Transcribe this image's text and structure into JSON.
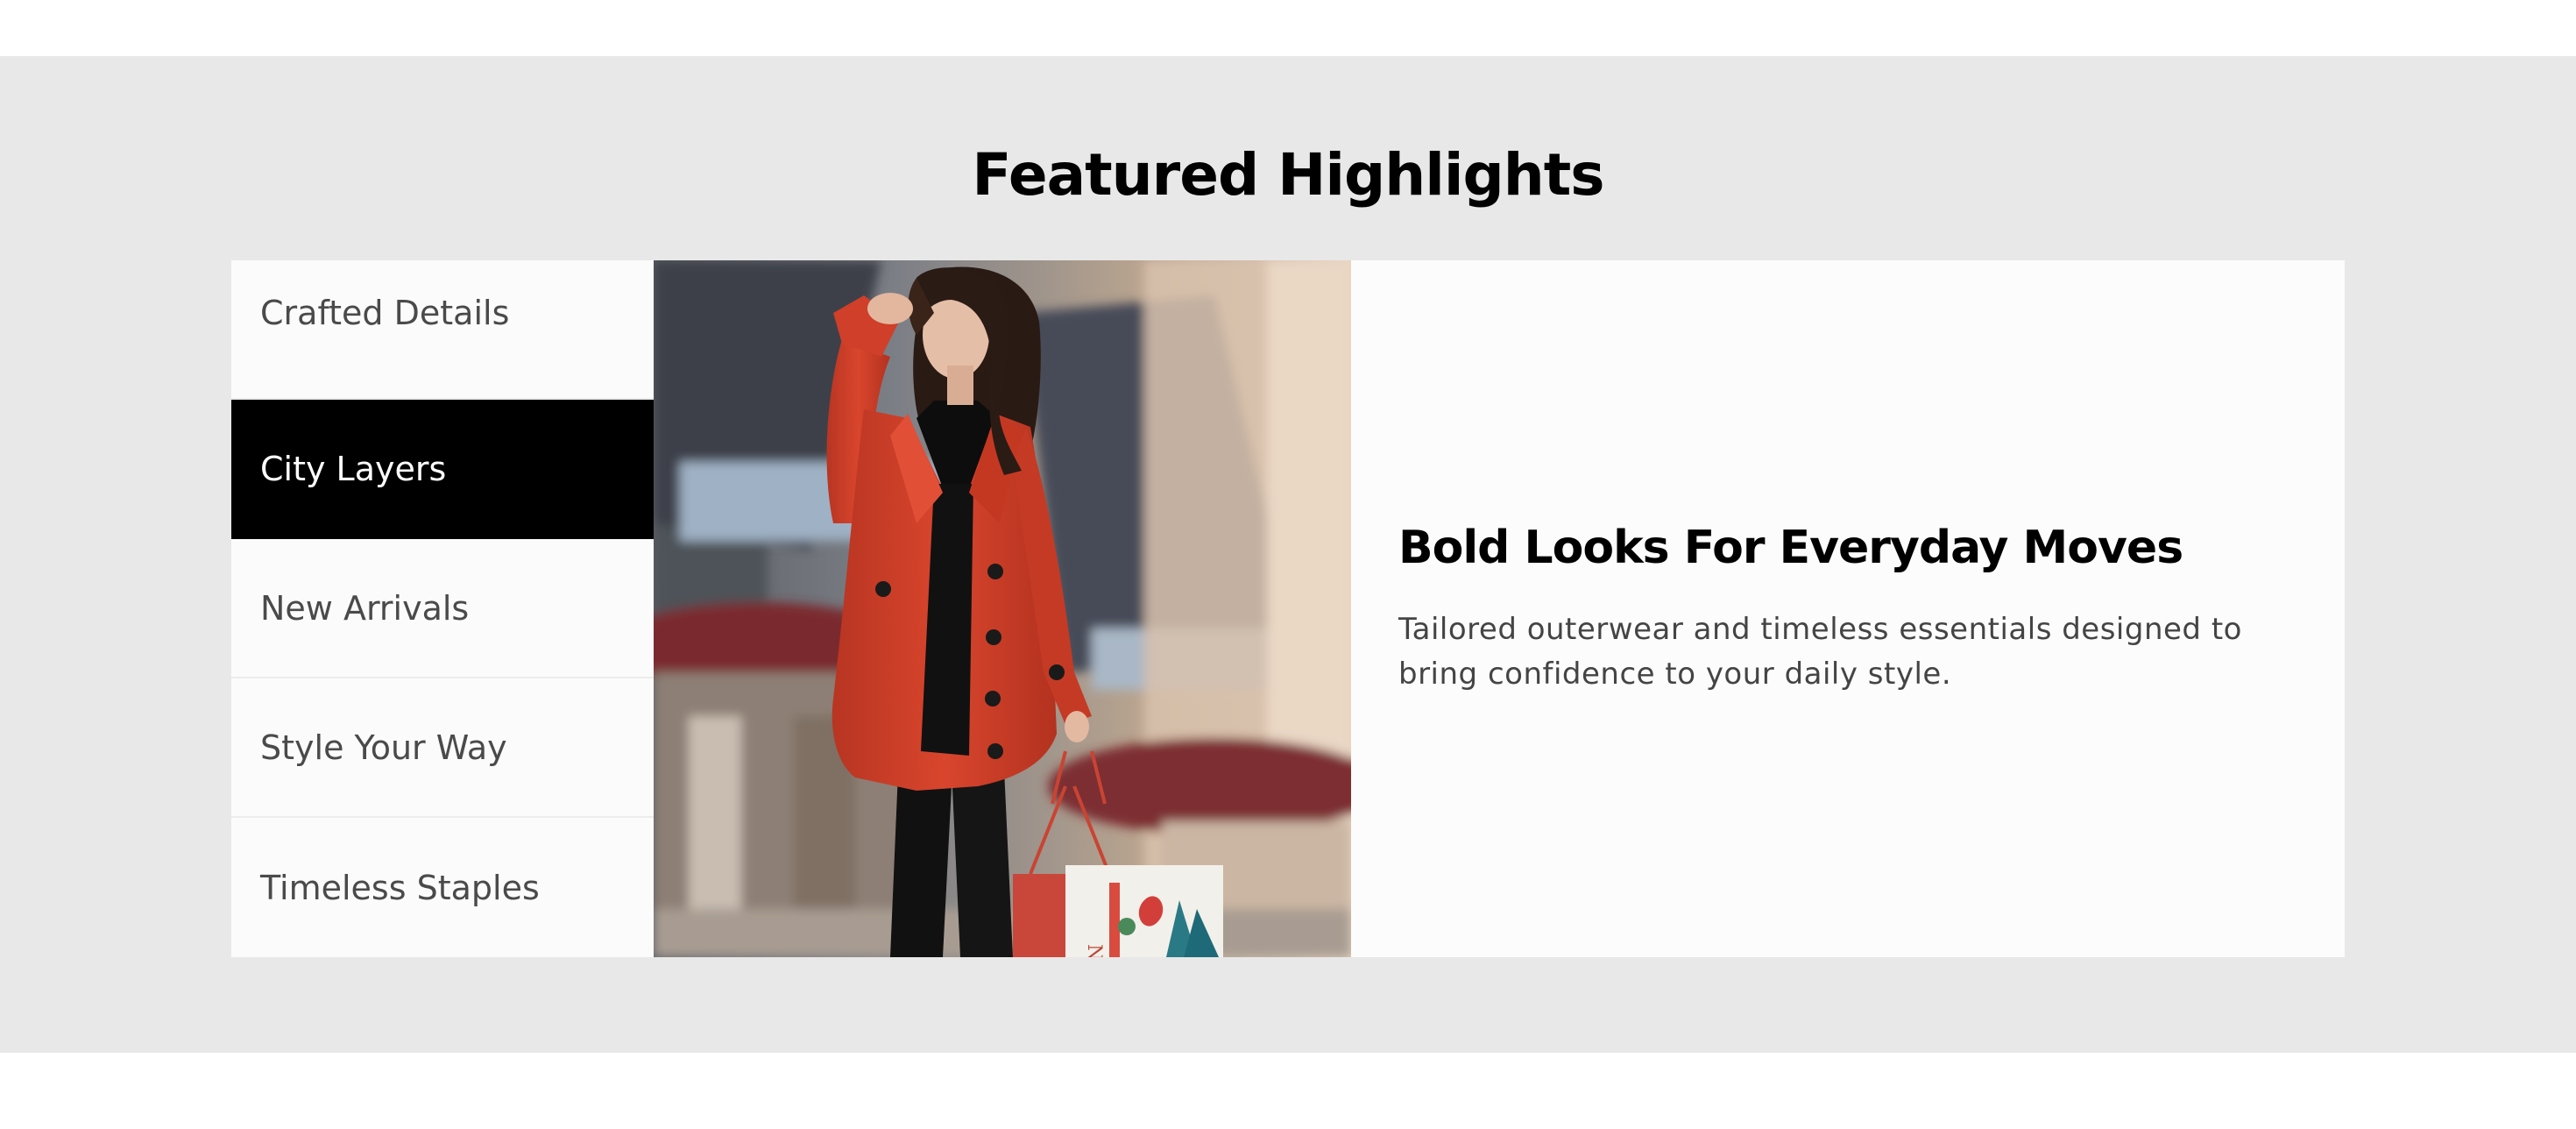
{
  "section": {
    "title": "Featured Highlights",
    "tabs": [
      {
        "label": "Crafted Details",
        "active": false
      },
      {
        "label": "City Layers",
        "active": true
      },
      {
        "label": "New Arrivals",
        "active": false
      },
      {
        "label": "Style Your Way",
        "active": false
      },
      {
        "label": "Timeless Staples",
        "active": false
      }
    ],
    "feature": {
      "image_subject": "woman-in-red-coat-with-shopping-bags",
      "heading": "Bold Looks For Everyday Moves",
      "description": "Tailored outerwear and timeless essentials designed to bring confidence to your daily style."
    }
  },
  "colors": {
    "section_bg": "#e8e8e8",
    "active_tab_bg": "#000000",
    "active_tab_text": "#ffffff",
    "tab_text": "#4a4a4a",
    "coat": "#d2412b"
  }
}
